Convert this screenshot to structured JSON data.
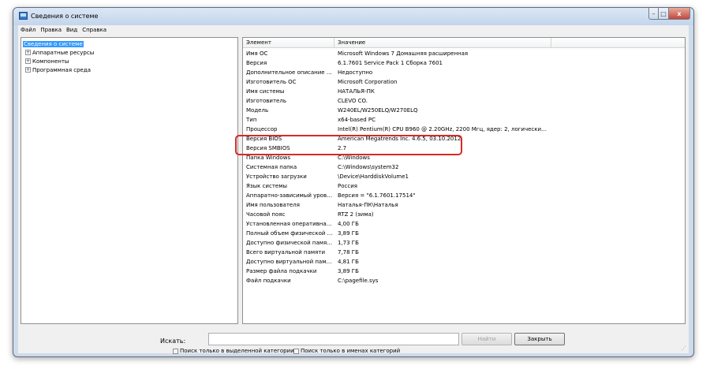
{
  "window": {
    "title": "Сведения о системе",
    "controls": {
      "minimize": "–",
      "maximize": "□",
      "close": "x"
    }
  },
  "menu": [
    "Файл",
    "Правка",
    "Вид",
    "Справка"
  ],
  "tree": {
    "items": [
      {
        "label": "Сведения о системе",
        "expander": "",
        "selected": true
      },
      {
        "label": "Аппаратные ресурсы",
        "expander": "+"
      },
      {
        "label": "Компоненты",
        "expander": "+"
      },
      {
        "label": "Программная среда",
        "expander": "+"
      }
    ]
  },
  "table": {
    "columns": [
      "Элемент",
      "Значение"
    ],
    "rows": [
      [
        "Имя ОС",
        "Microsoft Windows 7 Домашняя расширенная"
      ],
      [
        "Версия",
        "6.1.7601 Service Pack 1 Сборка 7601"
      ],
      [
        "Дополнительное описание ОС",
        "Недоступно"
      ],
      [
        "Изготовитель ОС",
        "Microsoft Corporation"
      ],
      [
        "Имя системы",
        "НАТАЛЬЯ-ПК"
      ],
      [
        "Изготовитель",
        "CLEVO CO."
      ],
      [
        "Модель",
        "W240EL/W250ELQ/W270ELQ"
      ],
      [
        "Тип",
        "x64-based PC"
      ],
      [
        "Процессор",
        "Intel(R) Pentium(R) CPU B960 @ 2.20GHz, 2200 Мгц, ядер: 2, логических про..."
      ],
      [
        "Версия BIOS",
        "American Megatrends Inc. 4.6.5, 03.10.2012"
      ],
      [
        "Версия SMBIOS",
        "2.7"
      ],
      [
        "Папка Windows",
        "C:\\Windows"
      ],
      [
        "Системная папка",
        "C:\\Windows\\system32"
      ],
      [
        "Устройство загрузки",
        "\\Device\\HarddiskVolume1"
      ],
      [
        "Язык системы",
        "Россия"
      ],
      [
        "Аппаратно-зависимый уровен...",
        "Версия = \"6.1.7601.17514\""
      ],
      [
        "Имя пользователя",
        "Наталья-ПК\\Наталья"
      ],
      [
        "Часовой пояс",
        "RTZ 2 (зима)"
      ],
      [
        "Установленная оперативная п...",
        "4,00 ГБ"
      ],
      [
        "Полный объем физической па...",
        "3,89 ГБ"
      ],
      [
        "Доступно физической памяти",
        "1,73 ГБ"
      ],
      [
        "Всего виртуальной памяти",
        "7,78 ГБ"
      ],
      [
        "Доступно виртуальной памяти",
        "4,81 ГБ"
      ],
      [
        "Размер файла подкачки",
        "3,89 ГБ"
      ],
      [
        "Файл подкачки",
        "C:\\pagefile.sys"
      ]
    ],
    "highlighted_rows": [
      "Версия BIOS",
      "Версия SMBIOS"
    ]
  },
  "search": {
    "label": "Искать:",
    "value": "",
    "find_button": "Найти",
    "close_button": "Закрыть",
    "checkbox_selected_category": "Поиск только в выделенной категории",
    "checkbox_category_names": "Поиск только в именах категорий"
  },
  "colors": {
    "selection": "#3399ff",
    "highlight_border": "#d82a24",
    "window_frame": "#cfdbe9"
  }
}
